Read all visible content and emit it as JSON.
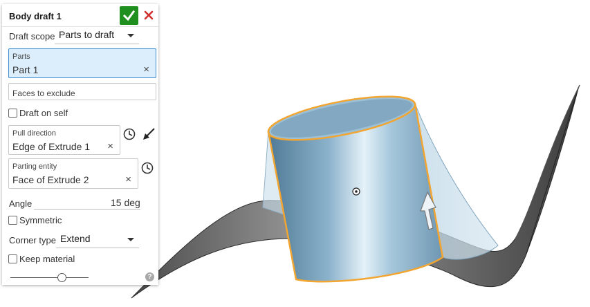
{
  "dialog": {
    "title": "Body draft 1",
    "draft_scope": {
      "label": "Draft scope",
      "value": "Parts to draft"
    },
    "parts": {
      "caption": "Parts",
      "value": "Part 1",
      "clear": "×"
    },
    "faces_to_exclude": {
      "placeholder": "Faces to exclude"
    },
    "draft_on_self": {
      "label": "Draft on self",
      "checked": false
    },
    "pull_direction": {
      "caption": "Pull direction",
      "value": "Edge of Extrude 1",
      "clear": "×"
    },
    "parting_entity": {
      "caption": "Parting entity",
      "value": "Face of Extrude 2",
      "clear": "×"
    },
    "angle": {
      "label": "Angle",
      "value": "15 deg"
    },
    "symmetric": {
      "label": "Symmetric",
      "checked": false
    },
    "corner_type": {
      "label": "Corner type",
      "value": "Extend"
    },
    "keep_material": {
      "label": "Keep material",
      "checked": false
    },
    "help": "?",
    "slider_level": 0.66
  },
  "icons": {
    "ok": "check-icon",
    "cancel": "close-icon",
    "flip": "flip-direction-icon",
    "clock": "clock-icon",
    "help": "help-icon"
  },
  "colors": {
    "confirm_green": "#1f8f1f",
    "cancel_red": "#d32f2f",
    "selection_blue": "#dceefb",
    "highlight_orange": "#f2a531",
    "part_blue": "#7fa9c6",
    "surface_gray": "#8a8a8a"
  }
}
